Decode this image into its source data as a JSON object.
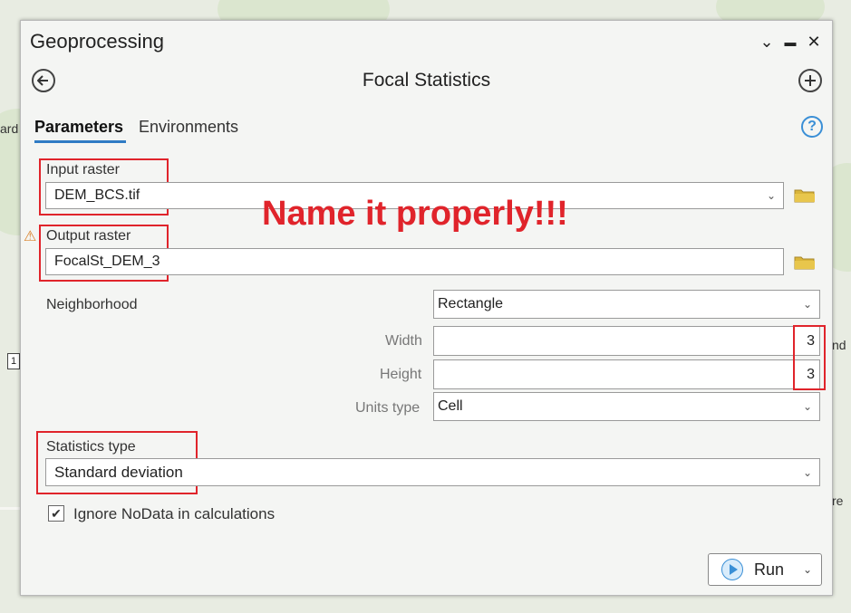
{
  "map": {
    "labels": [
      "ard",
      "nd",
      "re"
    ],
    "badge": "1"
  },
  "window": {
    "title": "Geoprocessing",
    "controls": [
      "⌄",
      "▬",
      "✕"
    ]
  },
  "tool": {
    "title": "Focal Statistics"
  },
  "tabs": {
    "parameters": "Parameters",
    "environments": "Environments"
  },
  "help_icon": "?",
  "params": {
    "input_raster": {
      "label": "Input raster",
      "value": "DEM_BCS.tif"
    },
    "output_raster": {
      "label": "Output raster",
      "value": "FocalSt_DEM_3"
    },
    "neighborhood": {
      "label": "Neighborhood",
      "value": "Rectangle"
    },
    "width": {
      "label": "Width",
      "value": "3"
    },
    "height": {
      "label": "Height",
      "value": "3"
    },
    "units_type": {
      "label": "Units type",
      "value": "Cell"
    },
    "statistics_type": {
      "label": "Statistics type",
      "value": "Standard deviation"
    },
    "ignore_nodata": {
      "label": "Ignore NoData in calculations",
      "checked": true,
      "mark": "✔"
    }
  },
  "annotation": "Name it properly!!!",
  "run_button": {
    "label": "Run"
  },
  "colors": {
    "annotation_red": "#e0242b",
    "accent_blue": "#2f7bc4",
    "folder_yellow": "#d9b53a"
  }
}
